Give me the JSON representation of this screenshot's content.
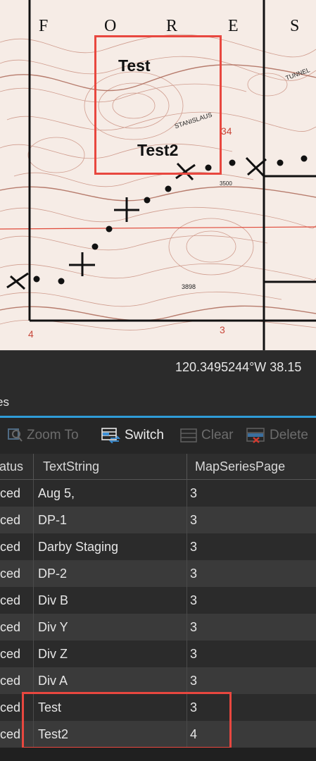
{
  "map": {
    "top_letters": [
      "F",
      "O",
      "R",
      "E",
      "S"
    ],
    "labels": [
      "Test",
      "Test2"
    ],
    "small_labels": [
      "STANISLAUS",
      "TUNNEL",
      "3500",
      "3898",
      "34",
      "3",
      "4"
    ],
    "highlight_color": "#e8473f"
  },
  "status_bar": {
    "coordinates": "120.3495244°W 38.15"
  },
  "pane": {
    "tab_title": "es"
  },
  "toolbar": {
    "zoom_to_label": "Zoom To",
    "switch_label": "Switch",
    "clear_label": "Clear",
    "delete_label": "Delete"
  },
  "table": {
    "columns": [
      "atus",
      "TextString",
      "MapSeriesPage"
    ],
    "rows": [
      {
        "status": "ced",
        "text": "Aug 5,",
        "page": "3"
      },
      {
        "status": "ced",
        "text": "DP-1",
        "page": "3"
      },
      {
        "status": "ced",
        "text": "Darby Staging",
        "page": "3"
      },
      {
        "status": "ced",
        "text": "DP-2",
        "page": "3"
      },
      {
        "status": "ced",
        "text": "Div B",
        "page": "3"
      },
      {
        "status": "ced",
        "text": "Div Y",
        "page": "3"
      },
      {
        "status": "ced",
        "text": "Div Z",
        "page": "3"
      },
      {
        "status": "ced",
        "text": "Div A",
        "page": "3"
      },
      {
        "status": "ced",
        "text": "Test",
        "page": "3"
      },
      {
        "status": "ced",
        "text": "Test2",
        "page": "4"
      }
    ]
  }
}
